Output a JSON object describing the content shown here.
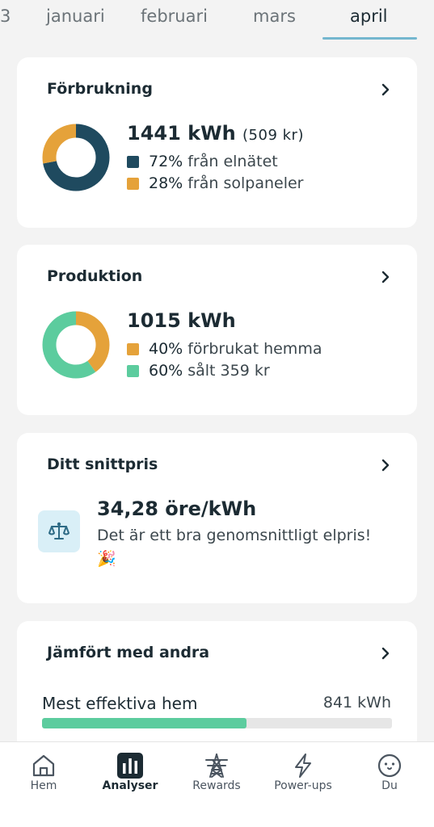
{
  "month_tabs": {
    "items": [
      {
        "label": "3"
      },
      {
        "label": "januari"
      },
      {
        "label": "februari"
      },
      {
        "label": "mars"
      },
      {
        "label": "april",
        "active": true
      }
    ],
    "accent_color": "#74b7cf"
  },
  "consumption": {
    "title": "Förbrukning",
    "total": "1441 kWh",
    "cost": "(509 kr)",
    "legend": [
      {
        "pct": "72%",
        "text": "från elnätet",
        "color": "#1f4a5f",
        "value": 72
      },
      {
        "pct": "28%",
        "text": "från solpaneler",
        "color": "#e5a23a",
        "value": 28
      }
    ]
  },
  "production": {
    "title": "Produktion",
    "total": "1015 kWh",
    "legend": [
      {
        "pct": "40%",
        "text": "förbrukat hemma",
        "color": "#e5a23a",
        "value": 40
      },
      {
        "pct": "60%",
        "text": "sålt 359 kr",
        "color": "#5ccc9e",
        "value": 60
      }
    ]
  },
  "avg_price": {
    "title": "Ditt snittpris",
    "value": "34,28 öre/kWh",
    "description": "Det är ett bra genomsnittligt elpris! 🎉",
    "icon": "scale-icon",
    "icon_bg": "#d9eff7"
  },
  "comparison": {
    "title": "Jämfört med andra",
    "row_label": "Mest effektiva hem",
    "row_value": "841 kWh",
    "fill_fraction": 0.585,
    "fill_color": "#5ccc9e"
  },
  "bottom_nav": {
    "items": [
      {
        "label": "Hem",
        "icon": "home-icon"
      },
      {
        "label": "Analyser",
        "icon": "bar-chart-icon",
        "active": true
      },
      {
        "label": "Rewards",
        "icon": "power-tower-icon"
      },
      {
        "label": "Power-ups",
        "icon": "lightning-icon"
      },
      {
        "label": "Du",
        "icon": "smiley-icon"
      }
    ]
  }
}
